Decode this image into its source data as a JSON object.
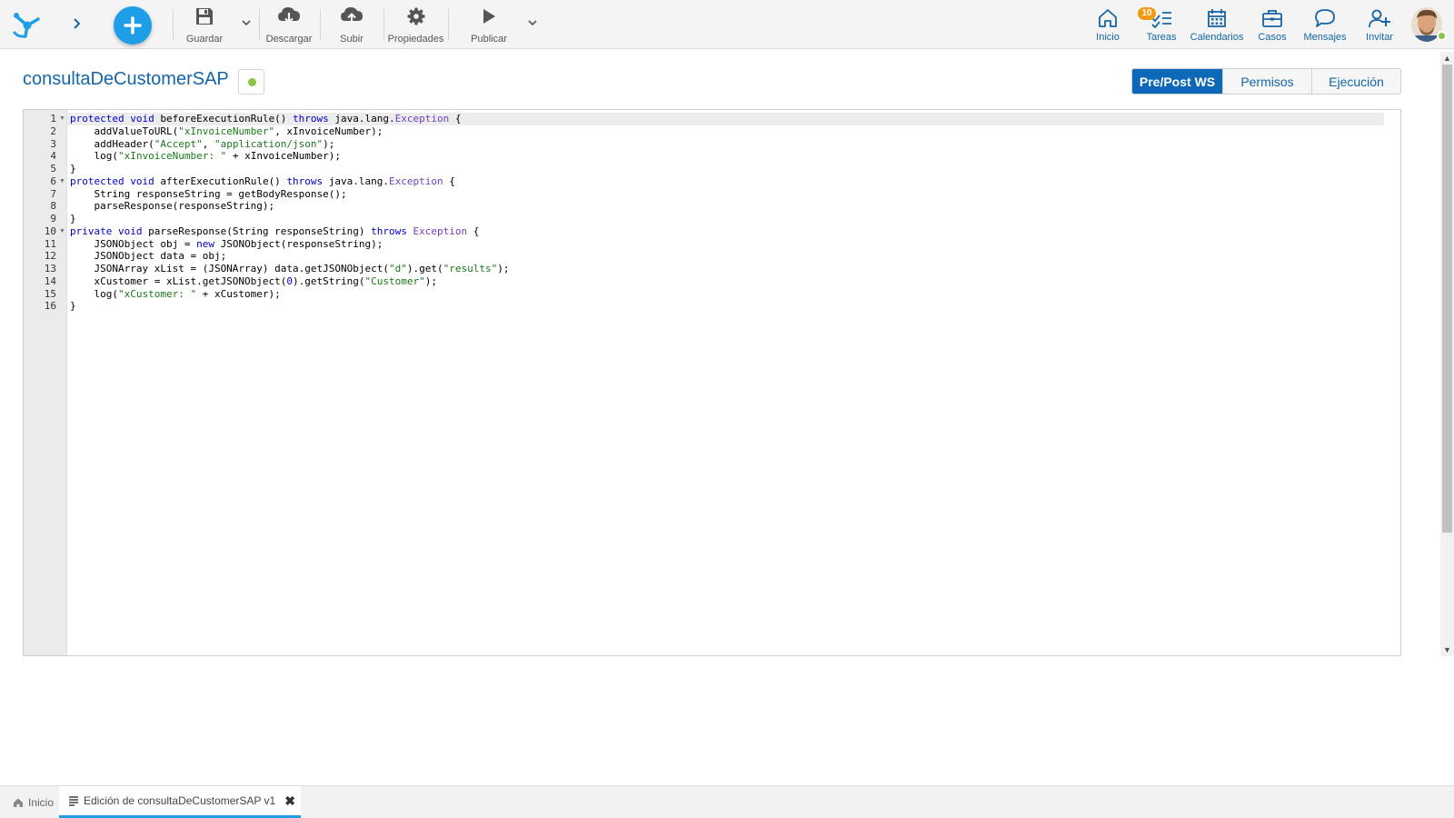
{
  "toolbar": {
    "tools": [
      {
        "label": "Guardar",
        "icon": "save-icon"
      },
      {
        "label": "Descargar",
        "icon": "cloud-download-icon"
      },
      {
        "label": "Subir",
        "icon": "cloud-upload-icon"
      },
      {
        "label": "Propiedades",
        "icon": "gear-icon"
      },
      {
        "label": "Publicar",
        "icon": "play-icon"
      }
    ],
    "nav": [
      {
        "label": "Inicio",
        "icon": "home-icon"
      },
      {
        "label": "Tareas",
        "icon": "tasks-icon",
        "badge": "10"
      },
      {
        "label": "Calendarios",
        "icon": "calendar-icon"
      },
      {
        "label": "Casos",
        "icon": "briefcase-icon"
      },
      {
        "label": "Mensajes",
        "icon": "chat-icon"
      },
      {
        "label": "Invitar",
        "icon": "add-user-icon"
      }
    ]
  },
  "header": {
    "title": "consultaDeCustomerSAP",
    "status_color": "#8bc34a",
    "tabs": [
      {
        "label": "Pre/Post WS",
        "active": true
      },
      {
        "label": "Permisos",
        "active": false
      },
      {
        "label": "Ejecución",
        "active": false
      }
    ]
  },
  "editor": {
    "language": "java",
    "lines": [
      "protected void beforeExecutionRule() throws java.lang.Exception {",
      "    addValueToURL(\"xInvoiceNumber\", xInvoiceNumber);",
      "    addHeader(\"Accept\", \"application/json\");",
      "    log(\"xInvoiceNumber: \" + xInvoiceNumber);",
      "}",
      "protected void afterExecutionRule() throws java.lang.Exception {",
      "    String responseString = getBodyResponse();",
      "    parseResponse(responseString);",
      "}",
      "private void parseResponse(String responseString) throws Exception {",
      "    JSONObject obj = new JSONObject(responseString);",
      "    JSONObject data = obj;",
      "    JSONArray xList = (JSONArray) data.getJSONObject(\"d\").get(\"results\");",
      "    xCustomer = xList.getJSONObject(0).getString(\"Customer\");",
      "    log(\"xCustomer: \" + xCustomer);",
      "}"
    ],
    "fold_lines": [
      1,
      6,
      10
    ],
    "active_line": 1
  },
  "bottom_tabs": [
    {
      "label": "Inicio",
      "icon": "home-icon",
      "active": false
    },
    {
      "label": "Edición de consultaDeCustomerSAP v1",
      "icon": "editor-icon",
      "active": true,
      "closable": true
    }
  ],
  "colors": {
    "accent": "#1e9ee6",
    "active_tab": "#0d68b8",
    "link": "#1565a8",
    "badge": "#f39c12"
  }
}
